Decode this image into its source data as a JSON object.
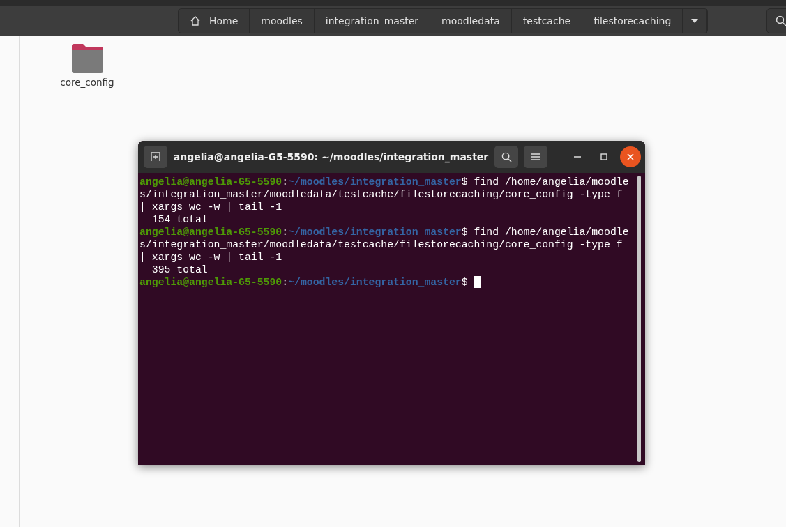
{
  "path_bar": [
    {
      "label": "Home",
      "kind": "home"
    },
    {
      "label": "moodles",
      "kind": "folder"
    },
    {
      "label": "integration_master",
      "kind": "folder"
    },
    {
      "label": "moodledata",
      "kind": "folder"
    },
    {
      "label": "testcache",
      "kind": "folder"
    },
    {
      "label": "filestorecaching",
      "kind": "folder"
    }
  ],
  "files": [
    {
      "name": "core_config"
    }
  ],
  "terminal": {
    "title": "angelia@angelia-G5-5590: ~/moodles/integration_master",
    "lines": [
      {
        "kind": "prompt",
        "user": "angelia@angelia-G5-5590",
        "sep": ":",
        "path": "~/moodles/integration_master",
        "command": "$ find /home/angelia/moodle",
        "cursor": false
      },
      {
        "kind": "output",
        "text": "s/integration_master/moodledata/testcache/filestorecaching/core_config -type f"
      },
      {
        "kind": "output",
        "text": "| xargs wc -w | tail -1"
      },
      {
        "kind": "output",
        "text": "  154 total"
      },
      {
        "kind": "prompt",
        "user": "angelia@angelia-G5-5590",
        "sep": ":",
        "path": "~/moodles/integration_master",
        "command": "$ find /home/angelia/moodle",
        "cursor": false
      },
      {
        "kind": "output",
        "text": "s/integration_master/moodledata/testcache/filestorecaching/core_config -type f"
      },
      {
        "kind": "output",
        "text": "| xargs wc -w | tail -1"
      },
      {
        "kind": "output",
        "text": "  395 total"
      },
      {
        "kind": "prompt",
        "user": "angelia@angelia-G5-5590",
        "sep": ":",
        "path": "~/moodles/integration_master",
        "command": "$ ",
        "cursor": true
      }
    ]
  }
}
